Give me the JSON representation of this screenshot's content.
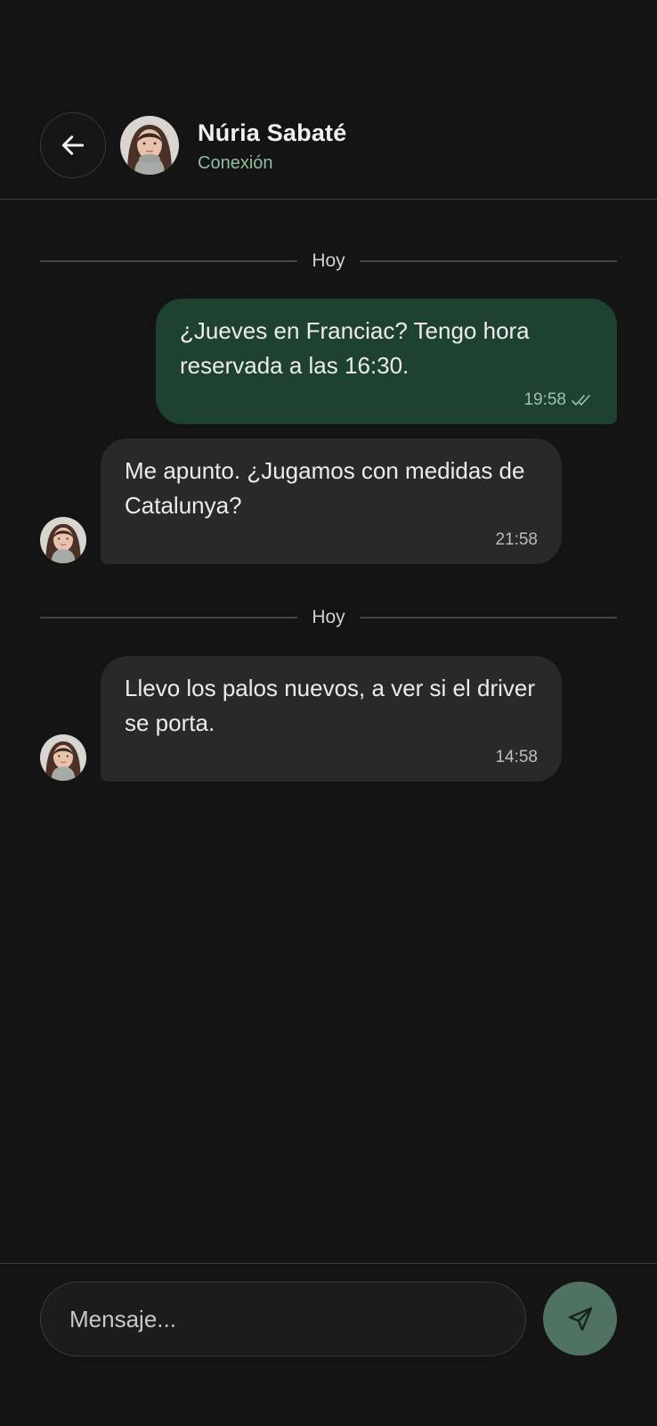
{
  "header": {
    "back_icon": "arrow-left-icon",
    "contact_name": "Núria Sabaté",
    "contact_status": "Conexión"
  },
  "messages": [
    {
      "type": "date",
      "label": "Hoy"
    },
    {
      "type": "outgoing",
      "text": "¿Jueves en Franciac? Tengo hora reservada a las 16:30.",
      "time": "19:58",
      "status_icon": "double-check-icon"
    },
    {
      "type": "incoming",
      "text": "Me apunto. ¿Jugamos con medidas de Catalunya?",
      "time": "21:58"
    },
    {
      "type": "date",
      "label": "Hoy"
    },
    {
      "type": "incoming",
      "text": "Llevo los palos nuevos, a ver si el driver se porta.",
      "time": "14:58"
    }
  ],
  "composer": {
    "placeholder": "Mensaje...",
    "send_icon": "send-icon"
  },
  "colors": {
    "background": "#141414",
    "outgoing_bubble": "#1f4230",
    "incoming_bubble": "#28292b",
    "status_green": "#8fbf9e",
    "send_button": "#4f7261"
  }
}
